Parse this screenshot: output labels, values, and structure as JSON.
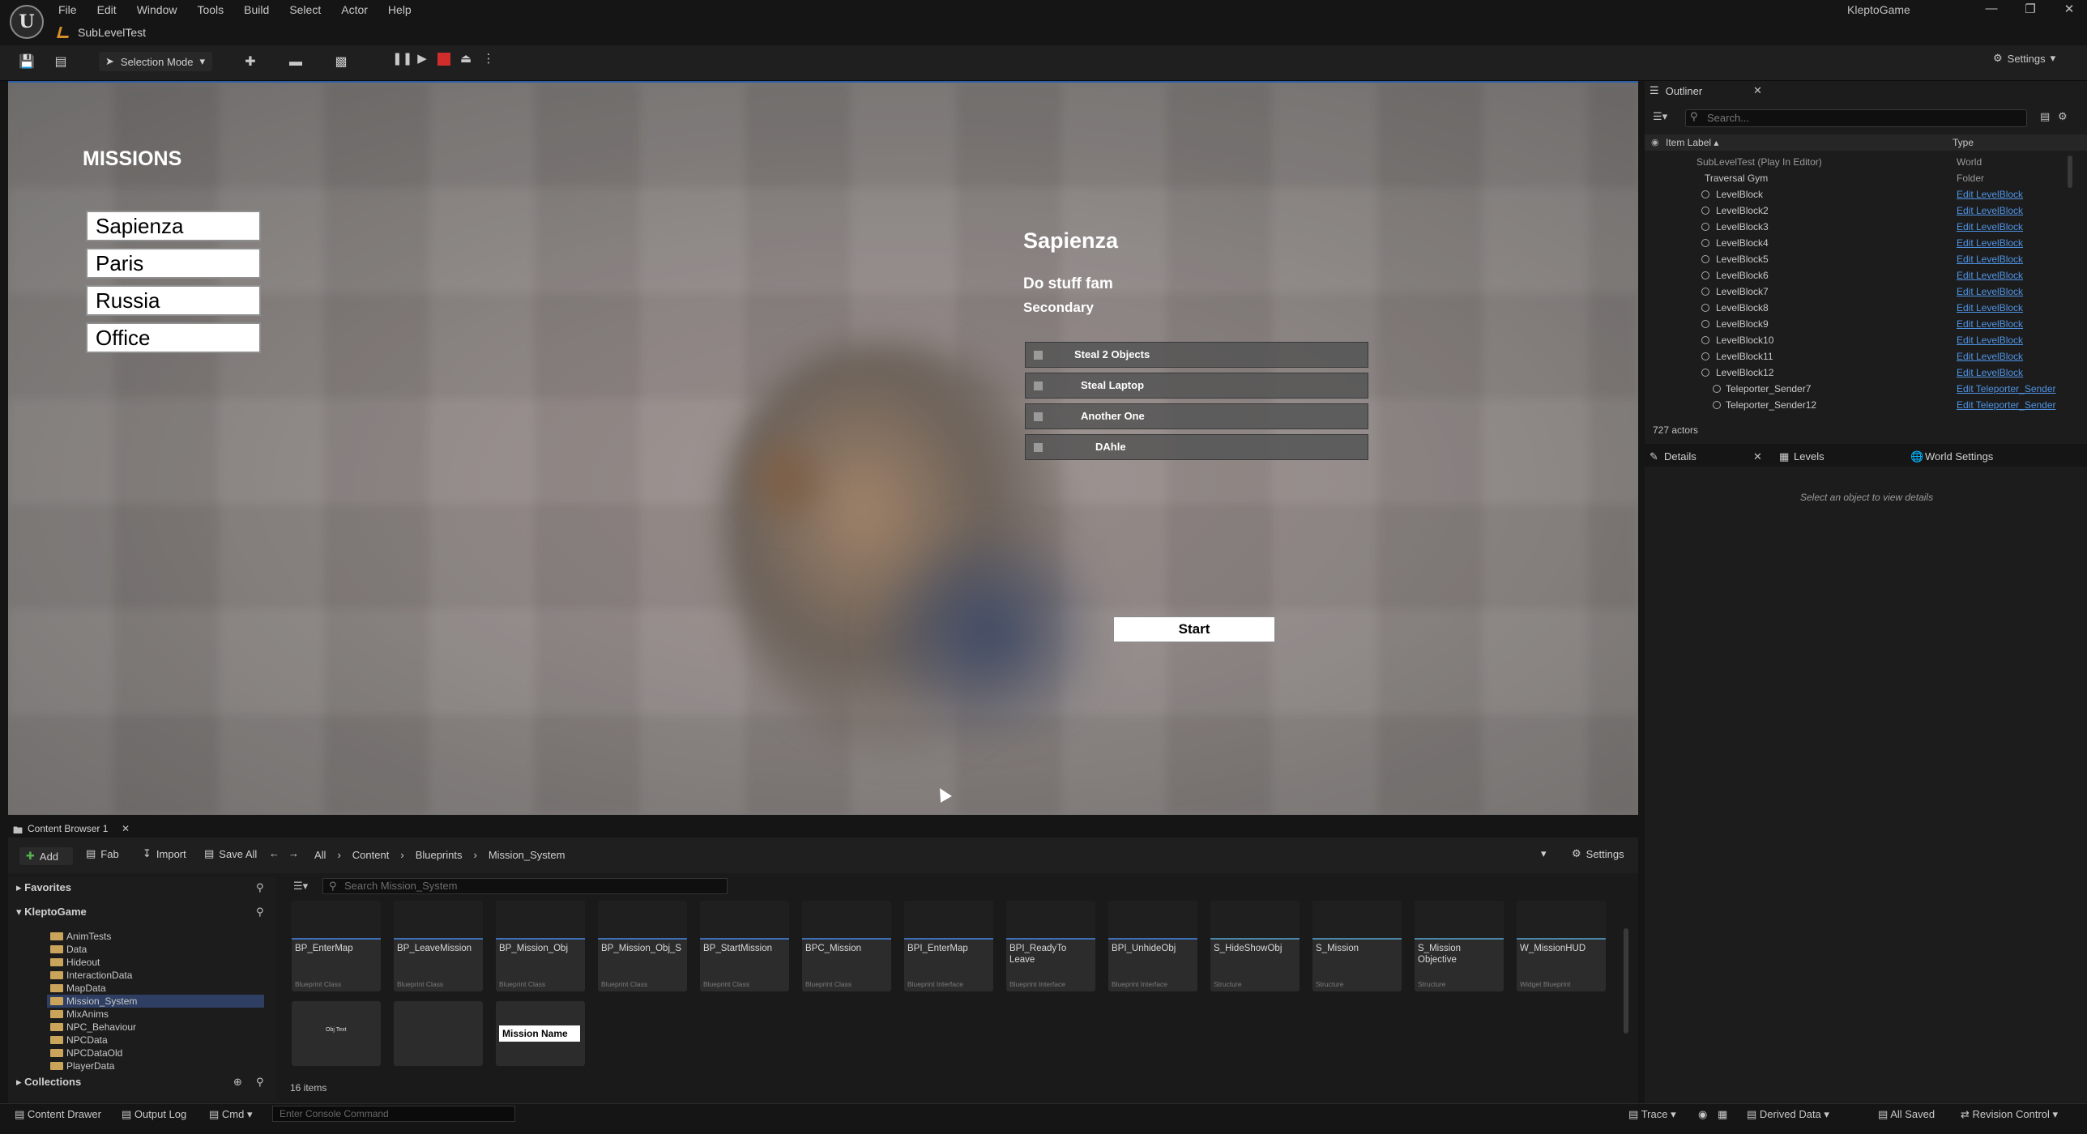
{
  "app": {
    "project_name": "KleptoGame",
    "level_tab": "SubLevelTest",
    "menu": [
      "File",
      "Edit",
      "Window",
      "Tools",
      "Build",
      "Select",
      "Actor",
      "Help"
    ]
  },
  "toolbar": {
    "selection_mode": "Selection Mode",
    "settings": "Settings"
  },
  "game_ui": {
    "missions_title": "MISSIONS",
    "missions": [
      "Sapienza",
      "Paris",
      "Russia",
      "Office"
    ],
    "detail_title": "Sapienza",
    "detail_description": "Do stuff fam",
    "detail_secondary": "Secondary",
    "objectives": [
      "Steal 2 Objects",
      "Steal Laptop",
      "Another One",
      "DAhle"
    ],
    "start_button": "Start"
  },
  "outliner": {
    "tab_title": "Outliner",
    "search_placeholder": "Search...",
    "col_label": "Item Label ▴",
    "col_type": "Type",
    "rows": [
      {
        "label": "SubLevelTest (Play In Editor)",
        "type": "World"
      },
      {
        "label": "Traversal Gym",
        "type": "Folder"
      },
      {
        "label": "LevelBlock",
        "type": "Edit LevelBlock"
      },
      {
        "label": "LevelBlock2",
        "type": "Edit LevelBlock"
      },
      {
        "label": "LevelBlock3",
        "type": "Edit LevelBlock"
      },
      {
        "label": "LevelBlock4",
        "type": "Edit LevelBlock"
      },
      {
        "label": "LevelBlock5",
        "type": "Edit LevelBlock"
      },
      {
        "label": "LevelBlock6",
        "type": "Edit LevelBlock"
      },
      {
        "label": "LevelBlock7",
        "type": "Edit LevelBlock"
      },
      {
        "label": "LevelBlock8",
        "type": "Edit LevelBlock"
      },
      {
        "label": "LevelBlock9",
        "type": "Edit LevelBlock"
      },
      {
        "label": "LevelBlock10",
        "type": "Edit LevelBlock"
      },
      {
        "label": "LevelBlock11",
        "type": "Edit LevelBlock"
      },
      {
        "label": "LevelBlock12",
        "type": "Edit LevelBlock"
      },
      {
        "label": "Teleporter_Sender7",
        "type": "Edit Teleporter_Sender"
      },
      {
        "label": "Teleporter_Sender12",
        "type": "Edit Teleporter_Sender"
      }
    ],
    "actors_count": "727 actors"
  },
  "details": {
    "tab_details": "Details",
    "tab_levels": "Levels",
    "tab_world_settings": "World Settings",
    "empty_text": "Select an object to view details"
  },
  "content_browser": {
    "tab_title": "Content Browser 1",
    "add": "Add",
    "fab": "Fab",
    "import": "Import",
    "save_all": "Save All",
    "path": [
      "All",
      "Content",
      "Blueprints",
      "Mission_System"
    ],
    "settings": "Settings",
    "favorites": "Favorites",
    "root": "KleptoGame",
    "folders": [
      "AnimTests",
      "Data",
      "Hideout",
      "InteractionData",
      "MapData",
      "Mission_System",
      "MixAnims",
      "NPC_Behaviour",
      "NPCData",
      "NPCDataOld",
      "PlayerData"
    ],
    "selected_folder": "Mission_System",
    "search_placeholder": "Search Mission_System",
    "collections": "Collections",
    "items_count": "16 items",
    "assets": [
      {
        "name": "BP_EnterMap",
        "class": "Blueprint Class",
        "color": "#3c6fb5"
      },
      {
        "name": "BP_LeaveMission",
        "class": "Blueprint Class",
        "color": "#3c6fb5"
      },
      {
        "name": "BP_Mission_Obj",
        "class": "Blueprint Class",
        "color": "#3c6fb5"
      },
      {
        "name": "BP_Mission_Obj_S",
        "class": "Blueprint Class",
        "color": "#3c6fb5"
      },
      {
        "name": "BP_StartMission",
        "class": "Blueprint Class",
        "color": "#3c6fb5"
      },
      {
        "name": "BPC_Mission",
        "class": "Blueprint Class",
        "color": "#3c6fb5"
      },
      {
        "name": "BPI_EnterMap",
        "class": "Blueprint Interface",
        "color": "#3c6fb5"
      },
      {
        "name": "BPI_ReadyTo Leave",
        "class": "Blueprint Interface",
        "color": "#3c6fb5"
      },
      {
        "name": "BPI_UnhideObj",
        "class": "Blueprint Interface",
        "color": "#3c6fb5"
      },
      {
        "name": "S_HideShowObj",
        "class": "Structure",
        "color": "#4a86a8"
      },
      {
        "name": "S_Mission",
        "class": "Structure",
        "color": "#4a86a8"
      },
      {
        "name": "S_Mission Objective",
        "class": "Structure",
        "color": "#4a86a8"
      },
      {
        "name": "W_MissionHUD",
        "class": "Widget Blueprint",
        "color": "#4a86a8"
      }
    ],
    "second_row_labels": [
      "Obj Text",
      "Mission Name"
    ]
  },
  "statusbar": {
    "content_drawer": "Content Drawer",
    "output_log": "Output Log",
    "cmd": "Cmd",
    "console_placeholder": "Enter Console Command",
    "trace": "Trace",
    "derived_data": "Derived Data",
    "all_saved": "All Saved",
    "revision_control": "Revision Control"
  }
}
